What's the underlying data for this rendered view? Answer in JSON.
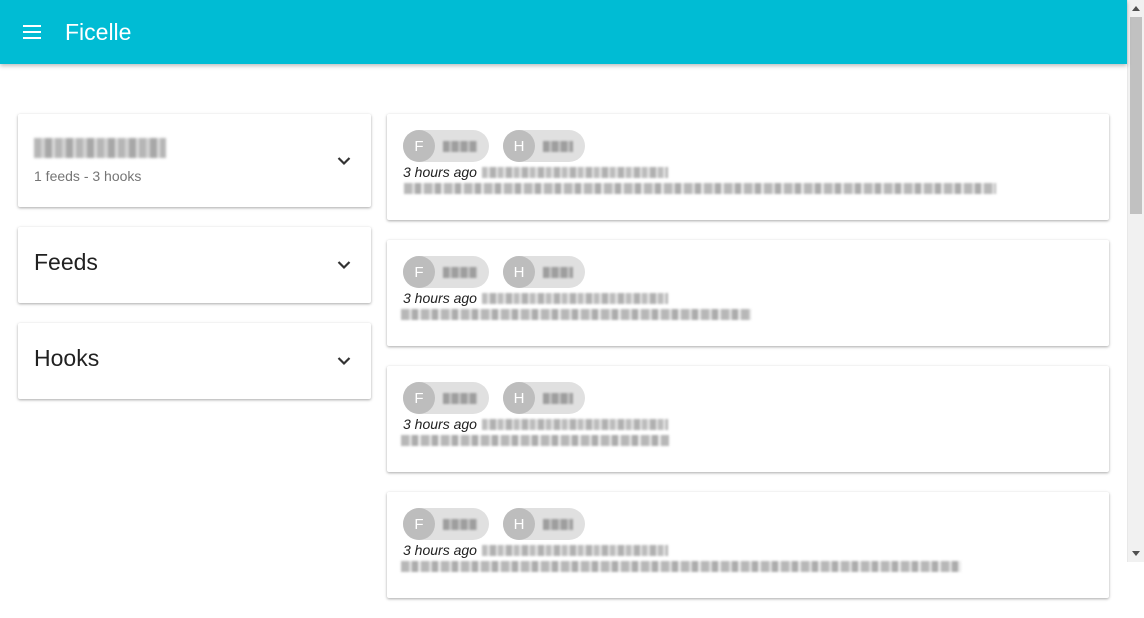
{
  "app": {
    "title": "Ficelle"
  },
  "sidebar": {
    "user_panel": {
      "subtitle": "1 feeds - 3 hooks"
    },
    "feeds_panel": {
      "title": "Feeds"
    },
    "hooks_panel": {
      "title": "Hooks"
    }
  },
  "events": [
    {
      "feed_chip": "F",
      "hook_chip": "H",
      "time": "3 hours ago"
    },
    {
      "feed_chip": "F",
      "hook_chip": "H",
      "time": "3 hours ago"
    },
    {
      "feed_chip": "F",
      "hook_chip": "H",
      "time": "3 hours ago"
    },
    {
      "feed_chip": "F",
      "hook_chip": "H",
      "time": "3 hours ago"
    }
  ],
  "colors": {
    "appbar": "#00bcd4",
    "chip_avatar": "#bdbdbd",
    "chip": "#e0e0e0"
  }
}
